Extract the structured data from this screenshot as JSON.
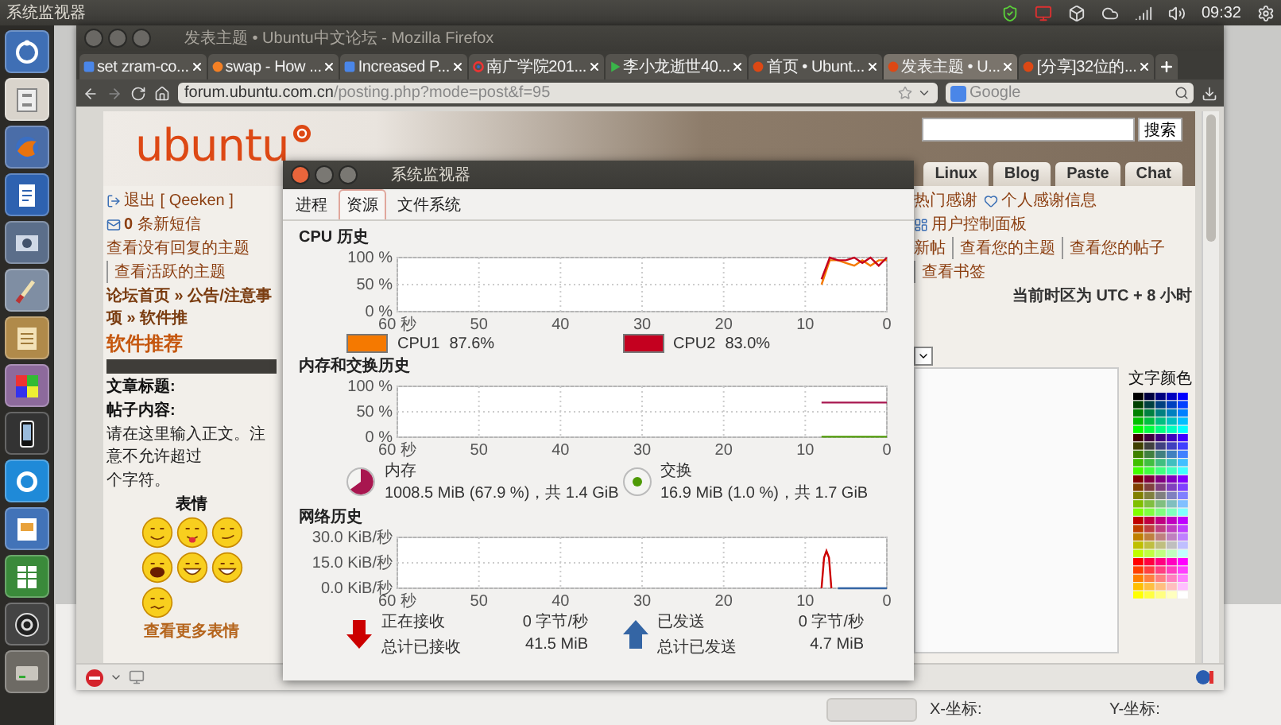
{
  "top_panel": {
    "app_title": "系统监视器",
    "clock": "09:32"
  },
  "launcher": {
    "items": [
      {
        "kind": "dash"
      },
      {
        "kind": "files"
      },
      {
        "kind": "browser"
      },
      {
        "kind": "writer"
      },
      {
        "kind": "photo"
      },
      {
        "kind": "brush"
      },
      {
        "kind": "notes"
      },
      {
        "kind": "palette"
      },
      {
        "kind": "device"
      },
      {
        "kind": "chat"
      },
      {
        "kind": "impress"
      },
      {
        "kind": "calc"
      },
      {
        "kind": "store"
      },
      {
        "kind": "drive"
      }
    ]
  },
  "background_window": {
    "x_label": "X-坐标:",
    "y_label": "Y-坐标:"
  },
  "firefox": {
    "title": "发表主题 • Ubuntu中文论坛 - Mozilla Firefox",
    "tabs": [
      {
        "label": "set zram-co...",
        "kind": "tile",
        "selected": false
      },
      {
        "label": "swap - How ...",
        "kind": "dot",
        "selected": false
      },
      {
        "label": "Increased P...",
        "kind": "tile",
        "selected": false
      },
      {
        "label": "南广学院201...",
        "kind": "ring",
        "selected": false
      },
      {
        "label": "李小龙逝世40...",
        "kind": "play",
        "selected": false
      },
      {
        "label": "首页 • Ubunt...",
        "kind": "logo",
        "selected": false
      },
      {
        "label": "发表主题 • U...",
        "kind": "logo",
        "selected": true
      },
      {
        "label": "[分享]32位的...",
        "kind": "logo",
        "selected": false
      }
    ],
    "url": "**forum.ubuntu.com.cn**/posting.php?mode=post&f=95",
    "search_placeholder": "Google"
  },
  "forum": {
    "logo": "ubuntu",
    "search_button": "搜索",
    "nav_tabs": [
      "Linux",
      "Blog",
      "Paste",
      "Chat"
    ],
    "user_links_left": [
      {
        "kind": "logout",
        "label": "退出 [ Qeeken ]"
      },
      {
        "kind": "messages",
        "label": "**0** 条新短信"
      }
    ],
    "user_links_right": [
      {
        "kind": "plain",
        "label": "热门感谢"
      },
      {
        "kind": "thanks",
        "label": "个人感谢信息"
      },
      {
        "kind": "panel",
        "label": "用户控制面板"
      }
    ],
    "view_links_left": [
      "查看没有回复的主题",
      "查看活跃的主题"
    ],
    "view_links_right": [
      "新帖",
      "查看您的主题",
      "查看您的帖子",
      "查看书签"
    ],
    "breadcrumb": "论坛首页 » 公告/注意事项 » 软件推",
    "timezone": "当前时区为 UTC + 8 小时",
    "heading": "软件推荐",
    "title_label": "文章标题:",
    "content_label": "帖子内容:",
    "content_hint": [
      "请在这里输入正文。注意不允许超过",
      "个字符。"
    ],
    "smilies_heading": "表情",
    "smilies": [
      {
        "kind": "grin"
      },
      {
        "kind": "tongue"
      },
      {
        "kind": "smirk"
      },
      {
        "kind": "laugh"
      },
      {
        "kind": "teeth"
      },
      {
        "kind": "teeth"
      },
      {
        "kind": "dizzy"
      }
    ],
    "more_smilies": "查看更多表情",
    "text_color_label": "文字颜色"
  },
  "system_monitor": {
    "title": "系统监视器",
    "tabs": [
      {
        "label": "进程",
        "selected": false
      },
      {
        "label": "资源",
        "selected": true
      },
      {
        "label": "文件系统",
        "selected": false
      }
    ],
    "cpu": {
      "heading": "CPU 历史",
      "chart_data": {
        "type": "line",
        "grid": true,
        "xlim": [
          60,
          0
        ],
        "ylim": [
          0,
          100
        ],
        "xticks": [
          {
            "value": 60,
            "label": "60 秒"
          },
          50,
          40,
          30,
          20,
          10,
          0
        ],
        "yticks": [
          {
            "value": 0,
            "label": "0 %"
          },
          {
            "value": 50,
            "label": "50 %"
          },
          {
            "value": 100,
            "label": "100 %"
          }
        ],
        "x": [
          8,
          7,
          6,
          5,
          4,
          3,
          2,
          1,
          0
        ],
        "series": [
          {
            "name": "CPU1",
            "color": "#f57900",
            "values": [
              50,
              95,
              95,
              90,
              85,
              95,
              85,
              95,
              95
            ]
          },
          {
            "name": "CPU2",
            "color": "#c4001f",
            "values": [
              60,
              100,
              95,
              95,
              100,
              90,
              100,
              85,
              100
            ]
          }
        ]
      },
      "readings": [
        "87.6%",
        "83.0%"
      ]
    },
    "memory": {
      "heading": "内存和交换历史",
      "chart_data": {
        "type": "line",
        "grid": true,
        "xlim": [
          60,
          0
        ],
        "ylim": [
          0,
          100
        ],
        "xticks": [
          {
            "value": 60,
            "label": "60 秒"
          },
          50,
          40,
          30,
          20,
          10,
          0
        ],
        "yticks": [
          {
            "value": 0,
            "label": "0 %"
          },
          {
            "value": 50,
            "label": "50 %"
          },
          {
            "value": 100,
            "label": "100 %"
          }
        ],
        "x": [
          8,
          0
        ],
        "series": [
          {
            "name": "内存",
            "color": "#a8164f",
            "values": [
              68,
              68
            ]
          },
          {
            "name": "交换",
            "color": "#4e9a06",
            "values": [
              1,
              1
            ]
          }
        ]
      },
      "legend": [
        {
          "kind": "pie",
          "reading": "1008.5 MiB (67.9 %)，共 1.4 GiB"
        },
        {
          "kind": "dot",
          "reading": "16.9 MiB (1.0 %)，共 1.7 GiB"
        }
      ]
    },
    "network": {
      "heading": "网络历史",
      "chart_data": {
        "type": "line",
        "grid": true,
        "xlim": [
          60,
          0
        ],
        "ylim": [
          0,
          30
        ],
        "xticks": [
          {
            "value": 60,
            "label": "60 秒"
          },
          50,
          40,
          30,
          20,
          10,
          0
        ],
        "yticks": [
          {
            "value": 0,
            "label": "0.0 KiB/秒"
          },
          {
            "value": 15,
            "label": "15.0 KiB/秒"
          },
          {
            "value": 30,
            "label": "30.0 KiB/秒"
          }
        ],
        "x": [
          8,
          7.7,
          7.4,
          7.1,
          6.8,
          6,
          5,
          4,
          3,
          2,
          1,
          0
        ],
        "series": [
          {
            "name": "正在接收",
            "color": "#cc0000",
            "values": [
              0,
              18,
              22,
              18,
              0,
              null,
              null,
              null,
              null,
              null,
              null,
              null
            ]
          },
          {
            "name": "已发送",
            "color": "#3465a4",
            "values": [
              null,
              null,
              null,
              null,
              null,
              0,
              0,
              0,
              0,
              0,
              0,
              0
            ]
          }
        ]
      },
      "legend": [
        {
          "kind": "receive",
          "rate": "0 字节/秒",
          "total_label": "总计已接收",
          "total": "41.5 MiB"
        },
        {
          "kind": "send",
          "rate": "0 字节/秒",
          "total_label": "总计已发送",
          "total": "4.7 MiB"
        }
      ]
    }
  }
}
